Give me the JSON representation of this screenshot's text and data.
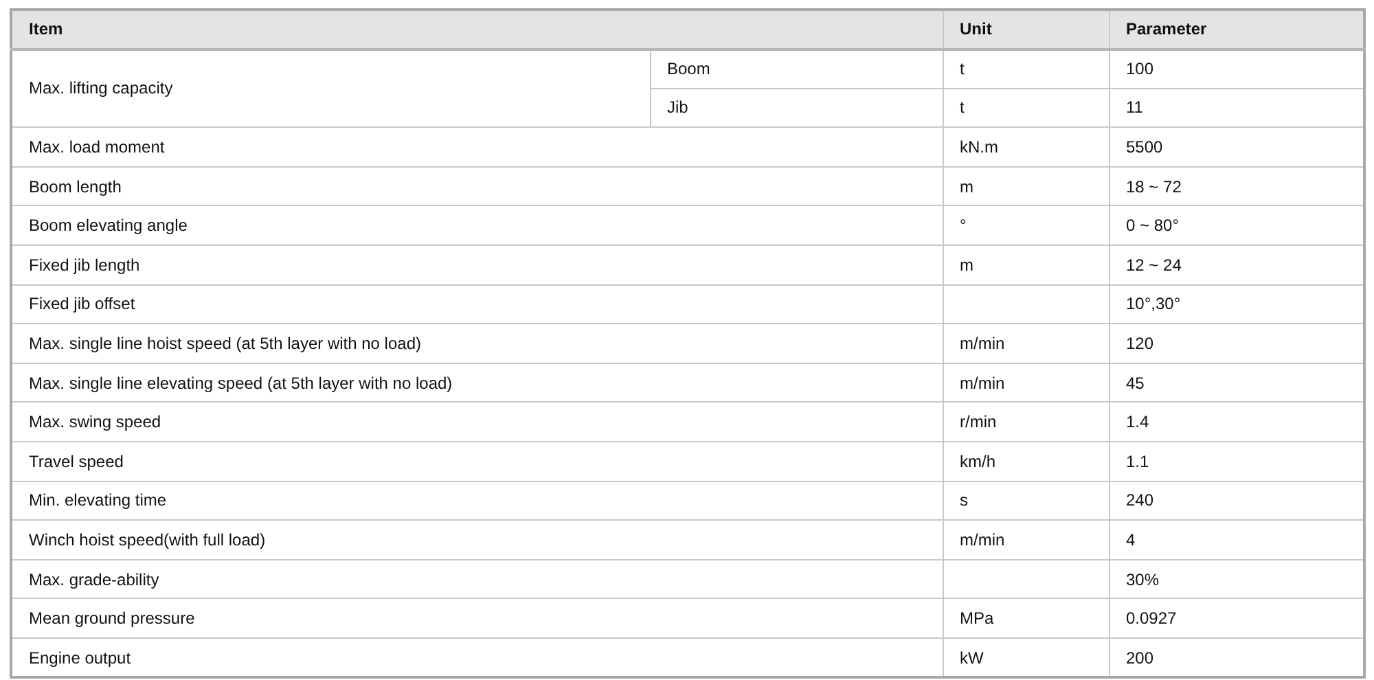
{
  "table": {
    "columns": [
      "Item",
      "Unit",
      "Parameter"
    ],
    "rows": [
      {
        "item": "Max. lifting capacity",
        "parts": [
          {
            "label": "Boom",
            "unit": "t",
            "parameter": "100"
          },
          {
            "label": "Jib",
            "unit": "t",
            "parameter": "11"
          }
        ]
      },
      {
        "item": "Max. load moment",
        "unit": "kN.m",
        "parameter": "5500"
      },
      {
        "item": "Boom length",
        "unit": "m",
        "parameter": "18 ~ 72"
      },
      {
        "item": "Boom elevating angle",
        "unit": "°",
        "parameter": "0 ~ 80°"
      },
      {
        "item": "Fixed jib length",
        "unit": "m",
        "parameter": "12 ~ 24"
      },
      {
        "item": "Fixed jib offset",
        "unit": "",
        "parameter": "10°,30°"
      },
      {
        "item": "Max. single line hoist speed (at 5th layer with no load)",
        "unit": "m/min",
        "parameter": "120"
      },
      {
        "item": "Max. single line elevating speed (at 5th layer with no load)",
        "unit": "m/min",
        "parameter": "45"
      },
      {
        "item": "Max. swing speed",
        "unit": "r/min",
        "parameter": "1.4"
      },
      {
        "item": "Travel speed",
        "unit": "km/h",
        "parameter": "1.1"
      },
      {
        "item": "Min. elevating time",
        "unit": "s",
        "parameter": "240"
      },
      {
        "item": "Winch hoist speed(with full load)",
        "unit": "m/min",
        "parameter": "4"
      },
      {
        "item": "Max. grade-ability",
        "unit": "",
        "parameter": "30%"
      },
      {
        "item": "Mean ground pressure",
        "unit": "MPa",
        "parameter": "0.0927"
      },
      {
        "item": "Engine output",
        "unit": "kW",
        "parameter": "200"
      }
    ]
  }
}
